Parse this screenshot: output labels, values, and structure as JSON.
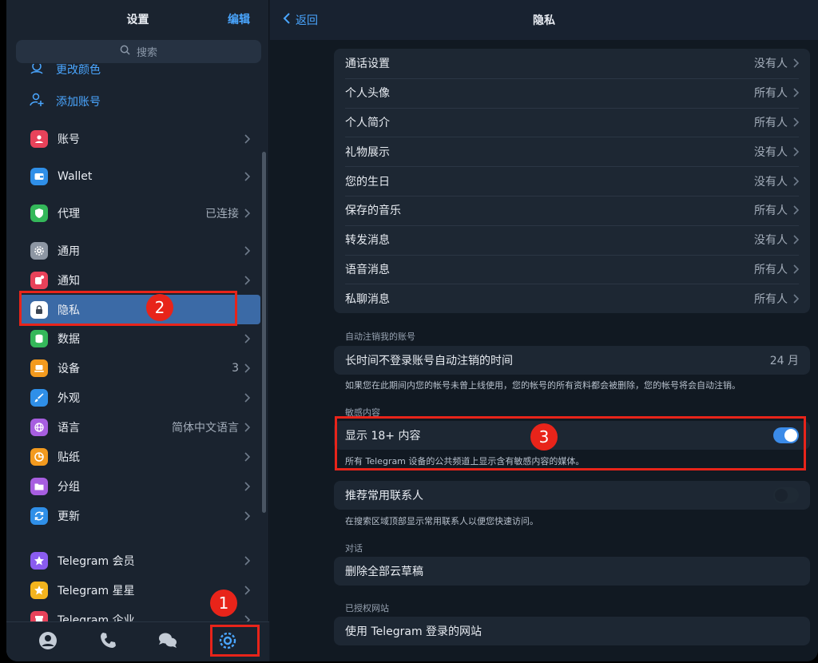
{
  "left": {
    "title": "设置",
    "edit": "编辑",
    "search_placeholder": "搜索",
    "change_color": "更改颜色",
    "add_account": "添加账号",
    "items": [
      {
        "label": "账号",
        "value": ""
      },
      {
        "label": "Wallet",
        "value": ""
      },
      {
        "label": "代理",
        "value": "已连接"
      },
      {
        "label": "通用",
        "value": ""
      },
      {
        "label": "通知",
        "value": ""
      },
      {
        "label": "隐私",
        "value": ""
      },
      {
        "label": "数据",
        "value": ""
      },
      {
        "label": "设备",
        "value": "3"
      },
      {
        "label": "外观",
        "value": ""
      },
      {
        "label": "语言",
        "value": "简体中文语言"
      },
      {
        "label": "贴纸",
        "value": ""
      },
      {
        "label": "分组",
        "value": ""
      },
      {
        "label": "更新",
        "value": ""
      },
      {
        "label": "Telegram 会员",
        "value": ""
      },
      {
        "label": "Telegram 星星",
        "value": ""
      },
      {
        "label": "Telegram 企业",
        "value": ""
      }
    ]
  },
  "right": {
    "back": "返回",
    "title": "隐私",
    "privacy_rows": [
      {
        "label": "通话设置",
        "value": "没有人"
      },
      {
        "label": "个人头像",
        "value": "所有人"
      },
      {
        "label": "个人简介",
        "value": "所有人"
      },
      {
        "label": "礼物展示",
        "value": "没有人"
      },
      {
        "label": "您的生日",
        "value": "没有人"
      },
      {
        "label": "保存的音乐",
        "value": "所有人"
      },
      {
        "label": "转发消息",
        "value": "没有人"
      },
      {
        "label": "语音消息",
        "value": "所有人"
      },
      {
        "label": "私聊消息",
        "value": "所有人"
      }
    ],
    "auto_delete": {
      "section": "自动注销我的账号",
      "label": "长时间不登录账号自动注销的时间",
      "value": "24 月",
      "note": "如果您在此期间内您的帐号未曾上线使用，您的帐号的所有资料都会被删除，您的帐号将会自动注销。"
    },
    "sensitive": {
      "section": "敏感内容",
      "label": "显示 18+ 内容",
      "enabled": true,
      "note": "所有 Telegram 设备的公共频道上显示含有敏感内容的媒体。"
    },
    "contacts": {
      "label": "推荐常用联系人",
      "enabled": false,
      "note": "在搜索区域顶部显示常用联系人以便您快速访问。"
    },
    "chats": {
      "section": "对话",
      "label": "删除全部云草稿"
    },
    "websites": {
      "section": "已授权网站",
      "label": "使用 Telegram 登录的网站"
    }
  },
  "annotations": [
    "1",
    "2",
    "3"
  ],
  "colors": {
    "accent": "#4aa6ff",
    "highlight": "#e8241a",
    "selected": "#3b6aa6"
  }
}
